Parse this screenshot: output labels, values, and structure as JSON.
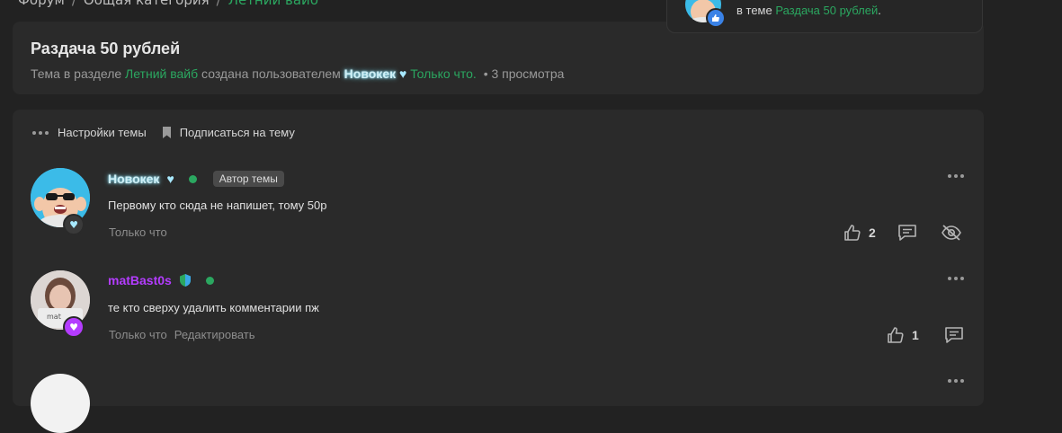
{
  "breadcrumb": {
    "items": [
      "Форум",
      "Общая категория",
      "Летний вайб"
    ],
    "separator": "/"
  },
  "thread": {
    "title": "Раздача 50 рублей",
    "meta_prefix": "Тема в разделе",
    "section": "Летний вайб",
    "created_by": "создана пользователем",
    "author": "Новокек",
    "time": "Только что.",
    "views": "• 3 просмотра"
  },
  "toolbar": {
    "settings_label": "Настройки темы",
    "subscribe_label": "Подписаться на тему"
  },
  "posts": [
    {
      "username": "Новокек",
      "badge": "Автор темы",
      "text": "Первому кто сюда не напишет, тому 50р",
      "time": "Только что",
      "likes": "2"
    },
    {
      "username": "matBast0s",
      "text": "те кто сверху удалить комментарии пж",
      "time": "Только что",
      "edit_label": "Редактировать",
      "likes": "1"
    }
  ],
  "notification": {
    "text_prefix": "в теме",
    "link": "Раздача 50 рублей",
    "suffix": "."
  },
  "colors": {
    "background": "#222222",
    "card": "#2a2a2a",
    "accent_green": "#2ba760",
    "glow_cyan": "#7fe3ff",
    "purple": "#b43cff"
  }
}
